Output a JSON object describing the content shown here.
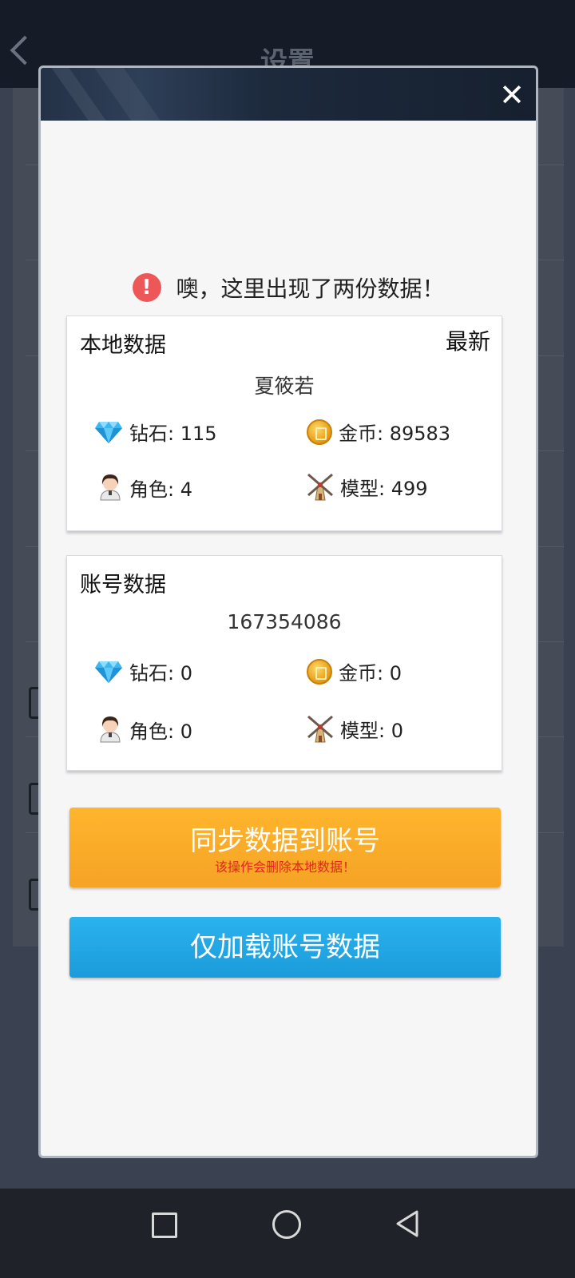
{
  "background": {
    "title": "设置"
  },
  "dialog": {
    "warning_text": "噢，这里出现了两份数据！",
    "local": {
      "title": "本地数据",
      "badge": "最新",
      "name": "夏筱若",
      "diamond": "钻石: 115",
      "gold": "金币: 89583",
      "role": "角色: 4",
      "model": "模型: 499"
    },
    "account": {
      "title": "账号数据",
      "name": "167354086",
      "diamond": "钻石: 0",
      "gold": "金币: 0",
      "role": "角色: 0",
      "model": "模型: 0"
    },
    "sync_button": "同步数据到账号",
    "sync_warning": "该操作会删除本地数据！",
    "load_button": "仅加载账号数据"
  },
  "icons": {
    "close": "close-icon",
    "warning": "warning-icon",
    "diamond": "diamond-icon",
    "gold": "gold-coin-icon",
    "role": "character-avatar-icon",
    "model": "windmill-icon"
  },
  "colors": {
    "sync_button": "#f7a928",
    "load_button": "#23a8e6",
    "warning": "#ee5757",
    "sync_warning_text": "#e0261c"
  }
}
